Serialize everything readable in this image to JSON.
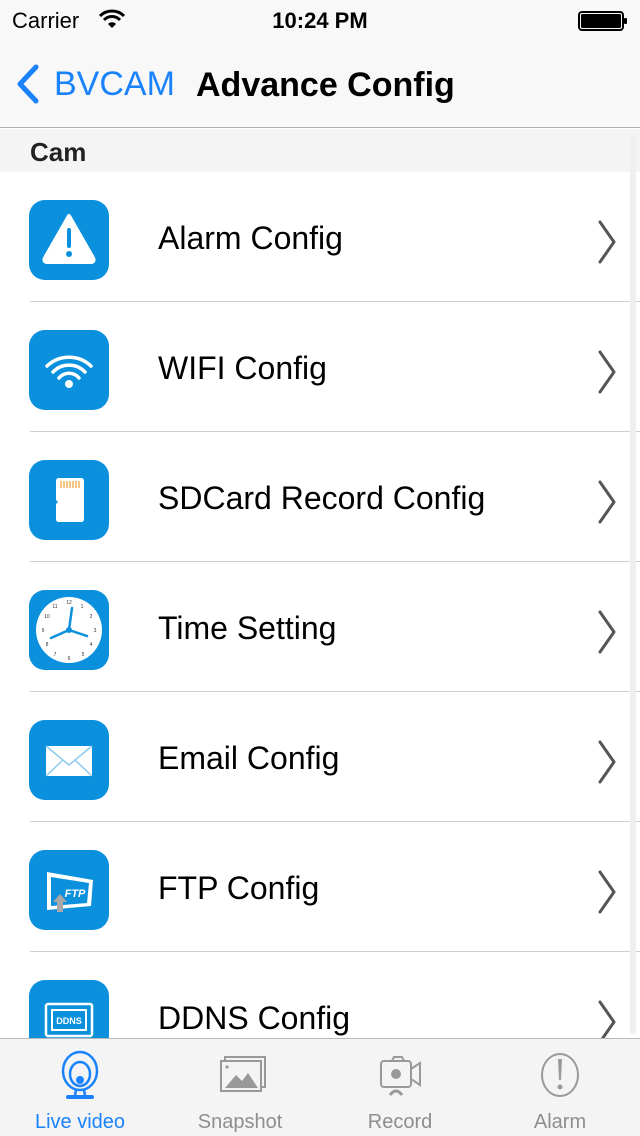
{
  "status_bar": {
    "carrier": "Carrier",
    "time": "10:24 PM",
    "wifi_icon": "wifi-icon",
    "battery_icon": "battery-full-icon"
  },
  "nav": {
    "back_label": "BVCAM",
    "title": "Advance Config",
    "back_icon": "chevron-left-icon"
  },
  "section": {
    "header": "Cam"
  },
  "list": {
    "items": [
      {
        "label": "Alarm Config",
        "icon": "alarm-warning-icon"
      },
      {
        "label": "WIFI Config",
        "icon": "wifi-icon"
      },
      {
        "label": "SDCard Record Config",
        "icon": "sd-card-icon"
      },
      {
        "label": "Time Setting",
        "icon": "clock-icon"
      },
      {
        "label": "Email Config",
        "icon": "envelope-icon"
      },
      {
        "label": "FTP Config",
        "icon": "ftp-upload-icon"
      },
      {
        "label": "DDNS Config",
        "icon": "ddns-monitor-icon"
      }
    ],
    "ftp_icon_text": "FTP",
    "ddns_icon_text": "DDNS"
  },
  "tab_bar": {
    "tabs": [
      {
        "label": "Live video",
        "icon": "webcam-icon",
        "active": true
      },
      {
        "label": "Snapshot",
        "icon": "picture-icon",
        "active": false
      },
      {
        "label": "Record",
        "icon": "video-camera-icon",
        "active": false
      },
      {
        "label": "Alarm",
        "icon": "exclamation-circle-icon",
        "active": false
      }
    ]
  },
  "colors": {
    "accent": "#1a82fb",
    "icon_tile": "#0a90dc",
    "tab_inactive": "#8e8e8e"
  }
}
